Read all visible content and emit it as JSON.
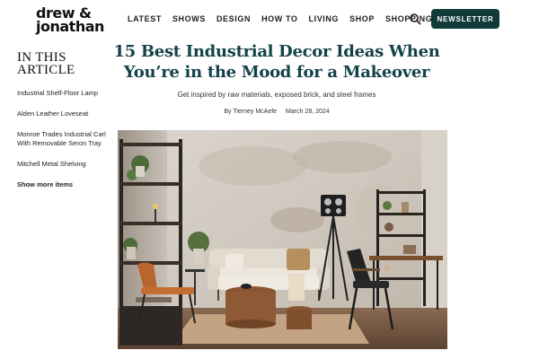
{
  "brand": {
    "logo_line1": "drew &",
    "logo_line2": "jonathan"
  },
  "nav": {
    "items": [
      "LATEST",
      "SHOWS",
      "DESIGN",
      "HOW TO",
      "LIVING",
      "SHOP",
      "SHOPPING"
    ],
    "newsletter_label": "NEWSLETTER"
  },
  "toc": {
    "title_line1": "IN THIS",
    "title_line2": "ARTICLE",
    "items": [
      "Industrial Shelf-Floor Lamp",
      "Alden Leather Loveseat",
      "Monroe Trades Industrial Carl With Removable Seron Tray",
      "Mitchell Metal Shelving"
    ],
    "more_label": "Show more items"
  },
  "article": {
    "headline": "15 Best Industrial Decor Ideas When You’re in the Mood for a Makeover",
    "subhead": "Get inspired by raw materials, exposed brick, and steel frames",
    "byline_prefix": "By",
    "author": "Tierney McAefe",
    "date": "March 28, 2024"
  },
  "colors": {
    "accent": "#113b3a",
    "headline": "#14424a"
  },
  "icons": {
    "search": "search-icon"
  }
}
